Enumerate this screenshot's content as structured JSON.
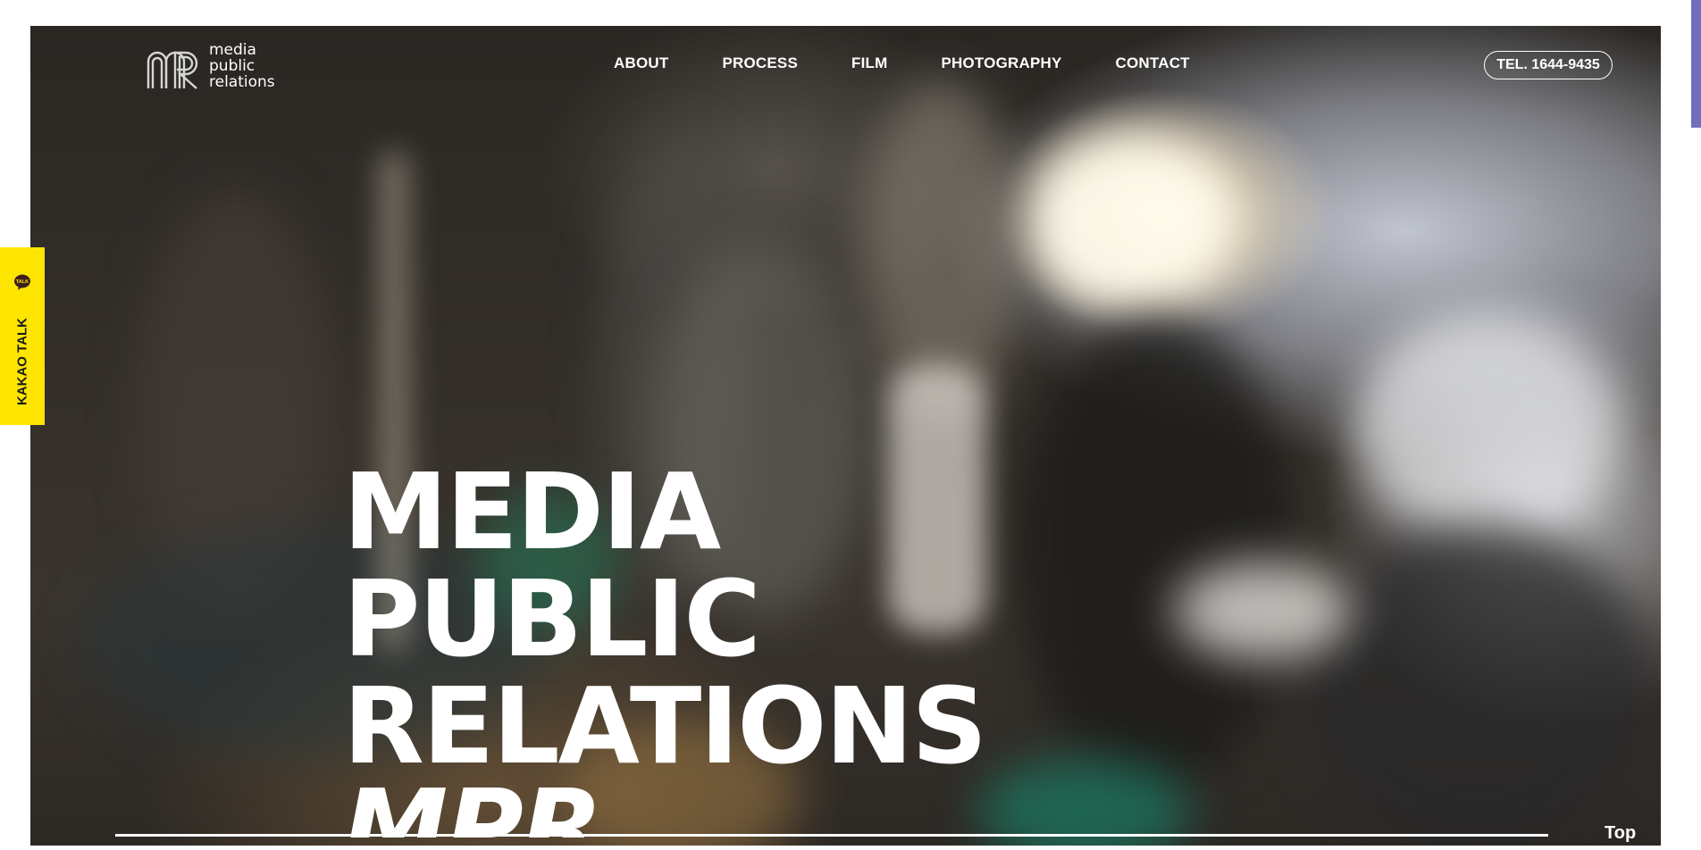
{
  "brand": {
    "logo_text_lines": [
      "media",
      "public",
      "relations"
    ],
    "logo_icon": "mr-monogram-icon"
  },
  "nav": {
    "items": [
      {
        "label": "ABOUT"
      },
      {
        "label": "PROCESS"
      },
      {
        "label": "FILM"
      },
      {
        "label": "PHOTOGRAPHY"
      },
      {
        "label": "CONTACT"
      }
    ]
  },
  "header": {
    "tel_label": "TEL. 1644-9435"
  },
  "hero": {
    "title_lines": [
      "MEDIA",
      "PUBLIC",
      "RELATIONS"
    ],
    "sub_partial": "MPR"
  },
  "footer": {
    "top_label": "Top"
  },
  "kakao": {
    "label": "KAKAO TALK",
    "icon_badge": "TALK",
    "icon": "kakao-talk-bubble-icon"
  },
  "colors": {
    "kakao_yellow": "#fee500",
    "scroll_thumb": "#6f6fbe",
    "text": "#ffffff"
  }
}
